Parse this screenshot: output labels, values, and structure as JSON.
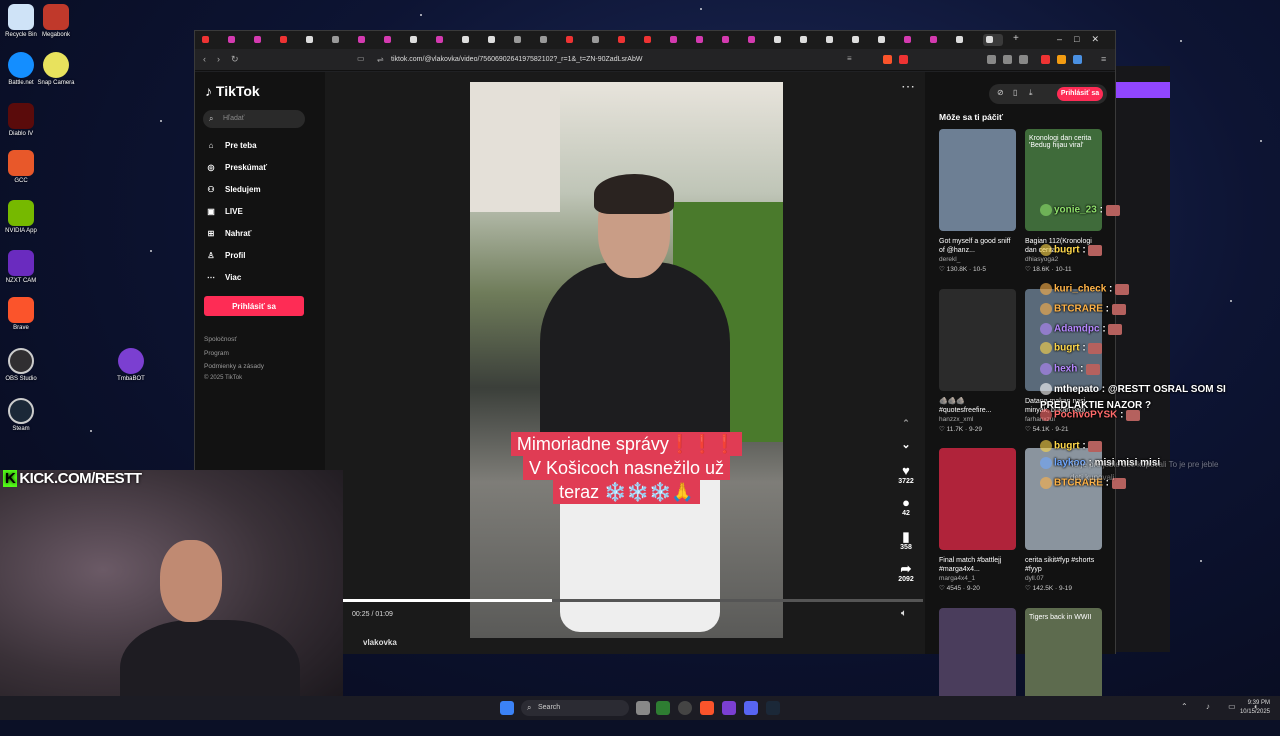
{
  "desktop": {
    "icons": [
      {
        "label": "Recycle Bin",
        "icon": "recycle-bin-icon",
        "color": "#cfe3f7"
      },
      {
        "label": "Megabonk",
        "icon": "megabonk-icon",
        "color": "#c0392b"
      },
      {
        "label": "Battle.net",
        "icon": "battlenet-icon",
        "color": "#148eff"
      },
      {
        "label": "Snap Camera",
        "icon": "snap-camera-icon",
        "color": "#e8e25d"
      },
      {
        "label": "Diablo IV",
        "icon": "diablo-icon",
        "color": "#5a0b0b"
      },
      {
        "label": "GCC",
        "icon": "gcc-icon",
        "color": "#e8582a"
      },
      {
        "label": "NVIDIA App",
        "icon": "nvidia-icon",
        "color": "#76b900"
      },
      {
        "label": "NZXT CAM",
        "icon": "nzxt-icon",
        "color": "#6a2bbf"
      },
      {
        "label": "Brave",
        "icon": "brave-icon",
        "color": "#fb542b"
      },
      {
        "label": "OBS Studio",
        "icon": "obs-icon",
        "color": "#302e31"
      },
      {
        "label": "Steam",
        "icon": "steam-icon",
        "color": "#1b2838"
      },
      {
        "label": "TmbaBOT",
        "icon": "tmbabot-icon",
        "color": "#7b3fd1"
      }
    ]
  },
  "browser": {
    "url": "tiktok.com/@vlakovka/video/7560690264197582102?_r=1&_t=ZN-90ZadLsrAbW",
    "controls": {
      "minimize": "–",
      "maximize": "□",
      "close": "✕"
    }
  },
  "tiktok": {
    "logo": "TikTok",
    "search_placeholder": "Hľadať",
    "nav": [
      "Pre teba",
      "Preskúmať",
      "Sledujem",
      "LIVE",
      "Nahrať",
      "Profil",
      "Viac"
    ],
    "login": "Prihlásiť sa",
    "footer": [
      "Spoločnosť",
      "Program",
      "Podmienky a zásady",
      "© 2025 TikTok"
    ],
    "video": {
      "caption": [
        "Mimoriadne správy❗❗❗",
        "V Košicoch nasnežilo už",
        "teraz ❄️❄️❄️🙏"
      ],
      "likes": "3722",
      "comments": "42",
      "saves": "358",
      "shares": "2092",
      "time": "00:25 / 01:09",
      "progress": 0.36,
      "author": "vlakovka"
    },
    "recs_title": "Môže sa ti páčiť",
    "recs_login": "Prihlásiť sa",
    "recs": [
      {
        "title": "Got myself a good sniff of @hanz...",
        "user": "derekl_",
        "likes": "130.8K",
        "date": "10-5",
        "color": "#6d7f94",
        "thumb_text": ""
      },
      {
        "title": "Bagian 112(Kronologi dan cerita ...",
        "user": "dhiasyoga2",
        "likes": "18.6K",
        "date": "10-11",
        "color": "#3f6b3a",
        "thumb_text": "Kronologi dan cerita 'Bedug hijau viral'"
      },
      {
        "title": "🪨🪨🪨 #quotesfreefire...",
        "user": "hanzzx_xml",
        "likes": "11.7K",
        "date": "9-29",
        "color": "#2b2b2b",
        "thumb_text": ""
      },
      {
        "title": "Datang makan nasi minyak, bukan bagi...",
        "user": "farhanxzui",
        "likes": "54.1K",
        "date": "9-21",
        "color": "#5a6a7a",
        "thumb_text": ""
      },
      {
        "title": "Final match #battlejj #marga4x4...",
        "user": "marga4x4_1",
        "likes": "4545",
        "date": "9-20",
        "color": "#b0233a",
        "thumb_text": ""
      },
      {
        "title": "cerita sikit#fyp #shorts #fyyp",
        "user": "dyll.07",
        "likes": "142.5K",
        "date": "9-19",
        "color": "#8a949e",
        "thumb_text": ""
      },
      {
        "title": "",
        "user": "",
        "likes": "",
        "date": "",
        "color": "#4a3d5c",
        "thumb_text": ""
      },
      {
        "title": "",
        "user": "",
        "likes": "",
        "date": "",
        "color": "#5d6b4e",
        "thumb_text": "Tigers back in WWII"
      }
    ]
  },
  "chat": [
    {
      "user": "yonie_23",
      "text": "",
      "color": "#8ee06b",
      "emote": true
    },
    {
      "user": "bugrt",
      "text": "",
      "color": "#ffd84a",
      "emote": true
    },
    {
      "user": "kuri_check",
      "text": "",
      "color": "#ffb347",
      "emote": true
    },
    {
      "user": "BTCRARE",
      "text": "",
      "color": "#ffb347",
      "emote": true
    },
    {
      "user": "Adamdpc",
      "text": "",
      "color": "#b688ff",
      "emote": true
    },
    {
      "user": "bugrt",
      "text": "",
      "color": "#ffd84a",
      "emote": true
    },
    {
      "user": "hexh",
      "text": "",
      "color": "#b688ff",
      "emote": true
    },
    {
      "user": "mthepato",
      "text": "@RESTT OSRAL SOM SI PREDLAKTIE NAZOR ?",
      "color": "#ffffff",
      "emote": false
    },
    {
      "user": "PochvoPYSK",
      "text": "",
      "color": "#ff6b6b",
      "emote": true
    },
    {
      "user": "bugrt",
      "text": "",
      "color": "#ffd84a",
      "emote": true
    },
    {
      "user": "laykoo",
      "text": "misi misi misi",
      "color": "#6fa8ff",
      "emote": false
    },
    {
      "user": "BTCRARE",
      "text": "",
      "color": "#ffb347",
      "emote": true
    },
    {
      "user": "",
      "text": "To je pre jeble deti kupovali To je pre jeble deti kupovali",
      "color": "#cccccc",
      "emote": false
    }
  ],
  "webcam": {
    "overlay": "KICK.COM/RESTT",
    "brand_color": "#53fc18"
  },
  "taskbar": {
    "search": "Search",
    "time": "9:39 PM",
    "date": "10/15/2025"
  }
}
